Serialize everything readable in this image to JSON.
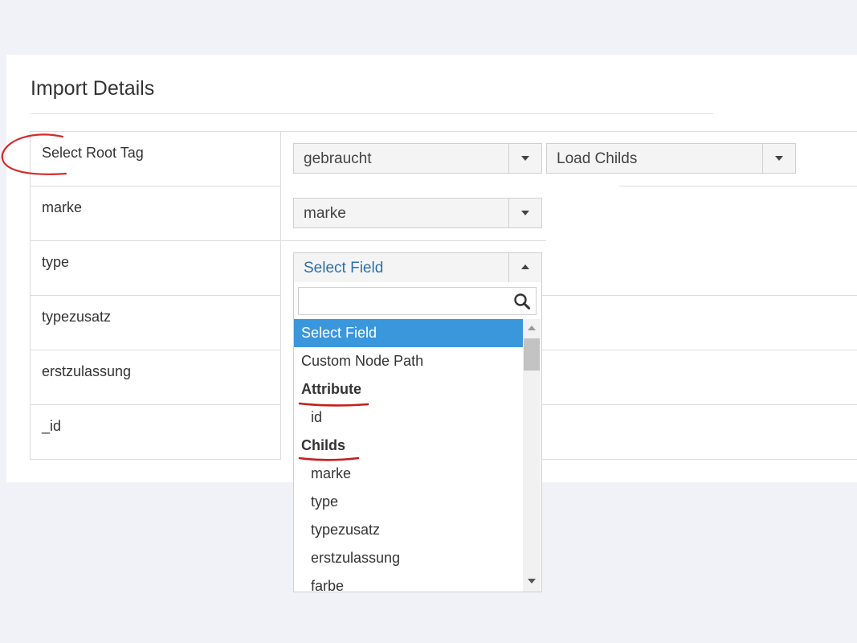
{
  "panel": {
    "title": "Import Details"
  },
  "rows": [
    {
      "label": "Select Root Tag"
    },
    {
      "label": "marke"
    },
    {
      "label": "type"
    },
    {
      "label": "typezusatz"
    },
    {
      "label": "erstzulassung"
    },
    {
      "label": "_id"
    }
  ],
  "root_tag": {
    "value": "gebraucht"
  },
  "load_childs": {
    "value": "Load Childs"
  },
  "marke_select": {
    "value": "marke"
  },
  "type_select": {
    "value": "Select Field",
    "open": true
  },
  "dropdown": {
    "search_value": "",
    "items": [
      {
        "label": "Select Field",
        "kind": "option",
        "selected": true
      },
      {
        "label": "Custom Node Path",
        "kind": "option"
      },
      {
        "label": "Attribute",
        "kind": "group"
      },
      {
        "label": "id",
        "kind": "child"
      },
      {
        "label": "Childs",
        "kind": "group"
      },
      {
        "label": "marke",
        "kind": "child"
      },
      {
        "label": "type",
        "kind": "child"
      },
      {
        "label": "typezusatz",
        "kind": "child"
      },
      {
        "label": "erstzulassung",
        "kind": "child"
      },
      {
        "label": "farbe",
        "kind": "child"
      }
    ]
  },
  "colors": {
    "selected_bg": "#3a97dc",
    "annotation": "#d42a2a",
    "open_select_text": "#2f6fa8"
  },
  "icons": [
    "search-icon",
    "chevron-down-icon",
    "chevron-up-icon"
  ]
}
